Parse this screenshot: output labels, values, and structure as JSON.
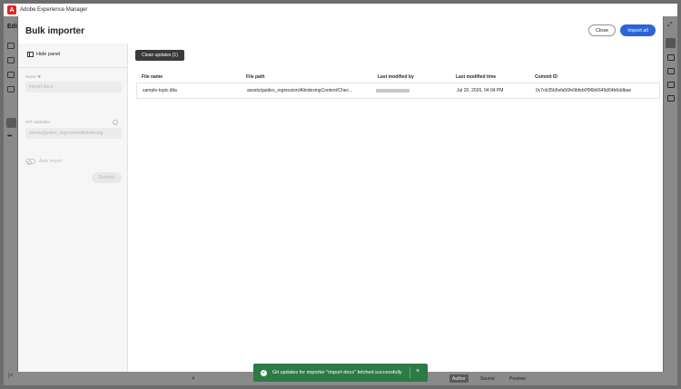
{
  "app": {
    "title": "Adobe Experience Manager",
    "logo_letter": "A",
    "rail_text": "Edi"
  },
  "modal": {
    "title": "Bulk importer",
    "close_label": "Close",
    "import_all_label": "Import all"
  },
  "side_panel": {
    "hide_panel_label": "Hide panel",
    "name_label": "Name ✱",
    "name_value": "import-docs",
    "git_label": "GIT subfolder",
    "git_value": "assets/guides_regression/AiIndexing",
    "auto_import_label": "Auto import",
    "refetch_label": "Refetch"
  },
  "content": {
    "clean_updates_label": "Clean updates (1)",
    "columns": [
      "File name",
      "File path",
      "Last modified by",
      "Last modified time",
      "Commit ID"
    ],
    "rows": [
      {
        "file_name": "sample-topic.dita",
        "file_path": "assets/guides_regression/AIindexingContent/Chec...",
        "last_modified_time": "Jul 20, 2026, 04:04 PM",
        "commit_id": "0c7cb35b5efa56fe9bfeb0f96b6649d64b6ddbae"
      }
    ]
  },
  "toast": {
    "message": "Git updates for importer \"import-docs\" fetched successfully",
    "icon": "check-circle-icon",
    "close_glyph": "×"
  },
  "bottom_bar": {
    "author_label": "Author",
    "source_label": "Source",
    "preview_label": "Preview"
  },
  "colors": {
    "primary": "#2b63d9",
    "toast": "#2d7a45",
    "brand": "#e1251b"
  }
}
